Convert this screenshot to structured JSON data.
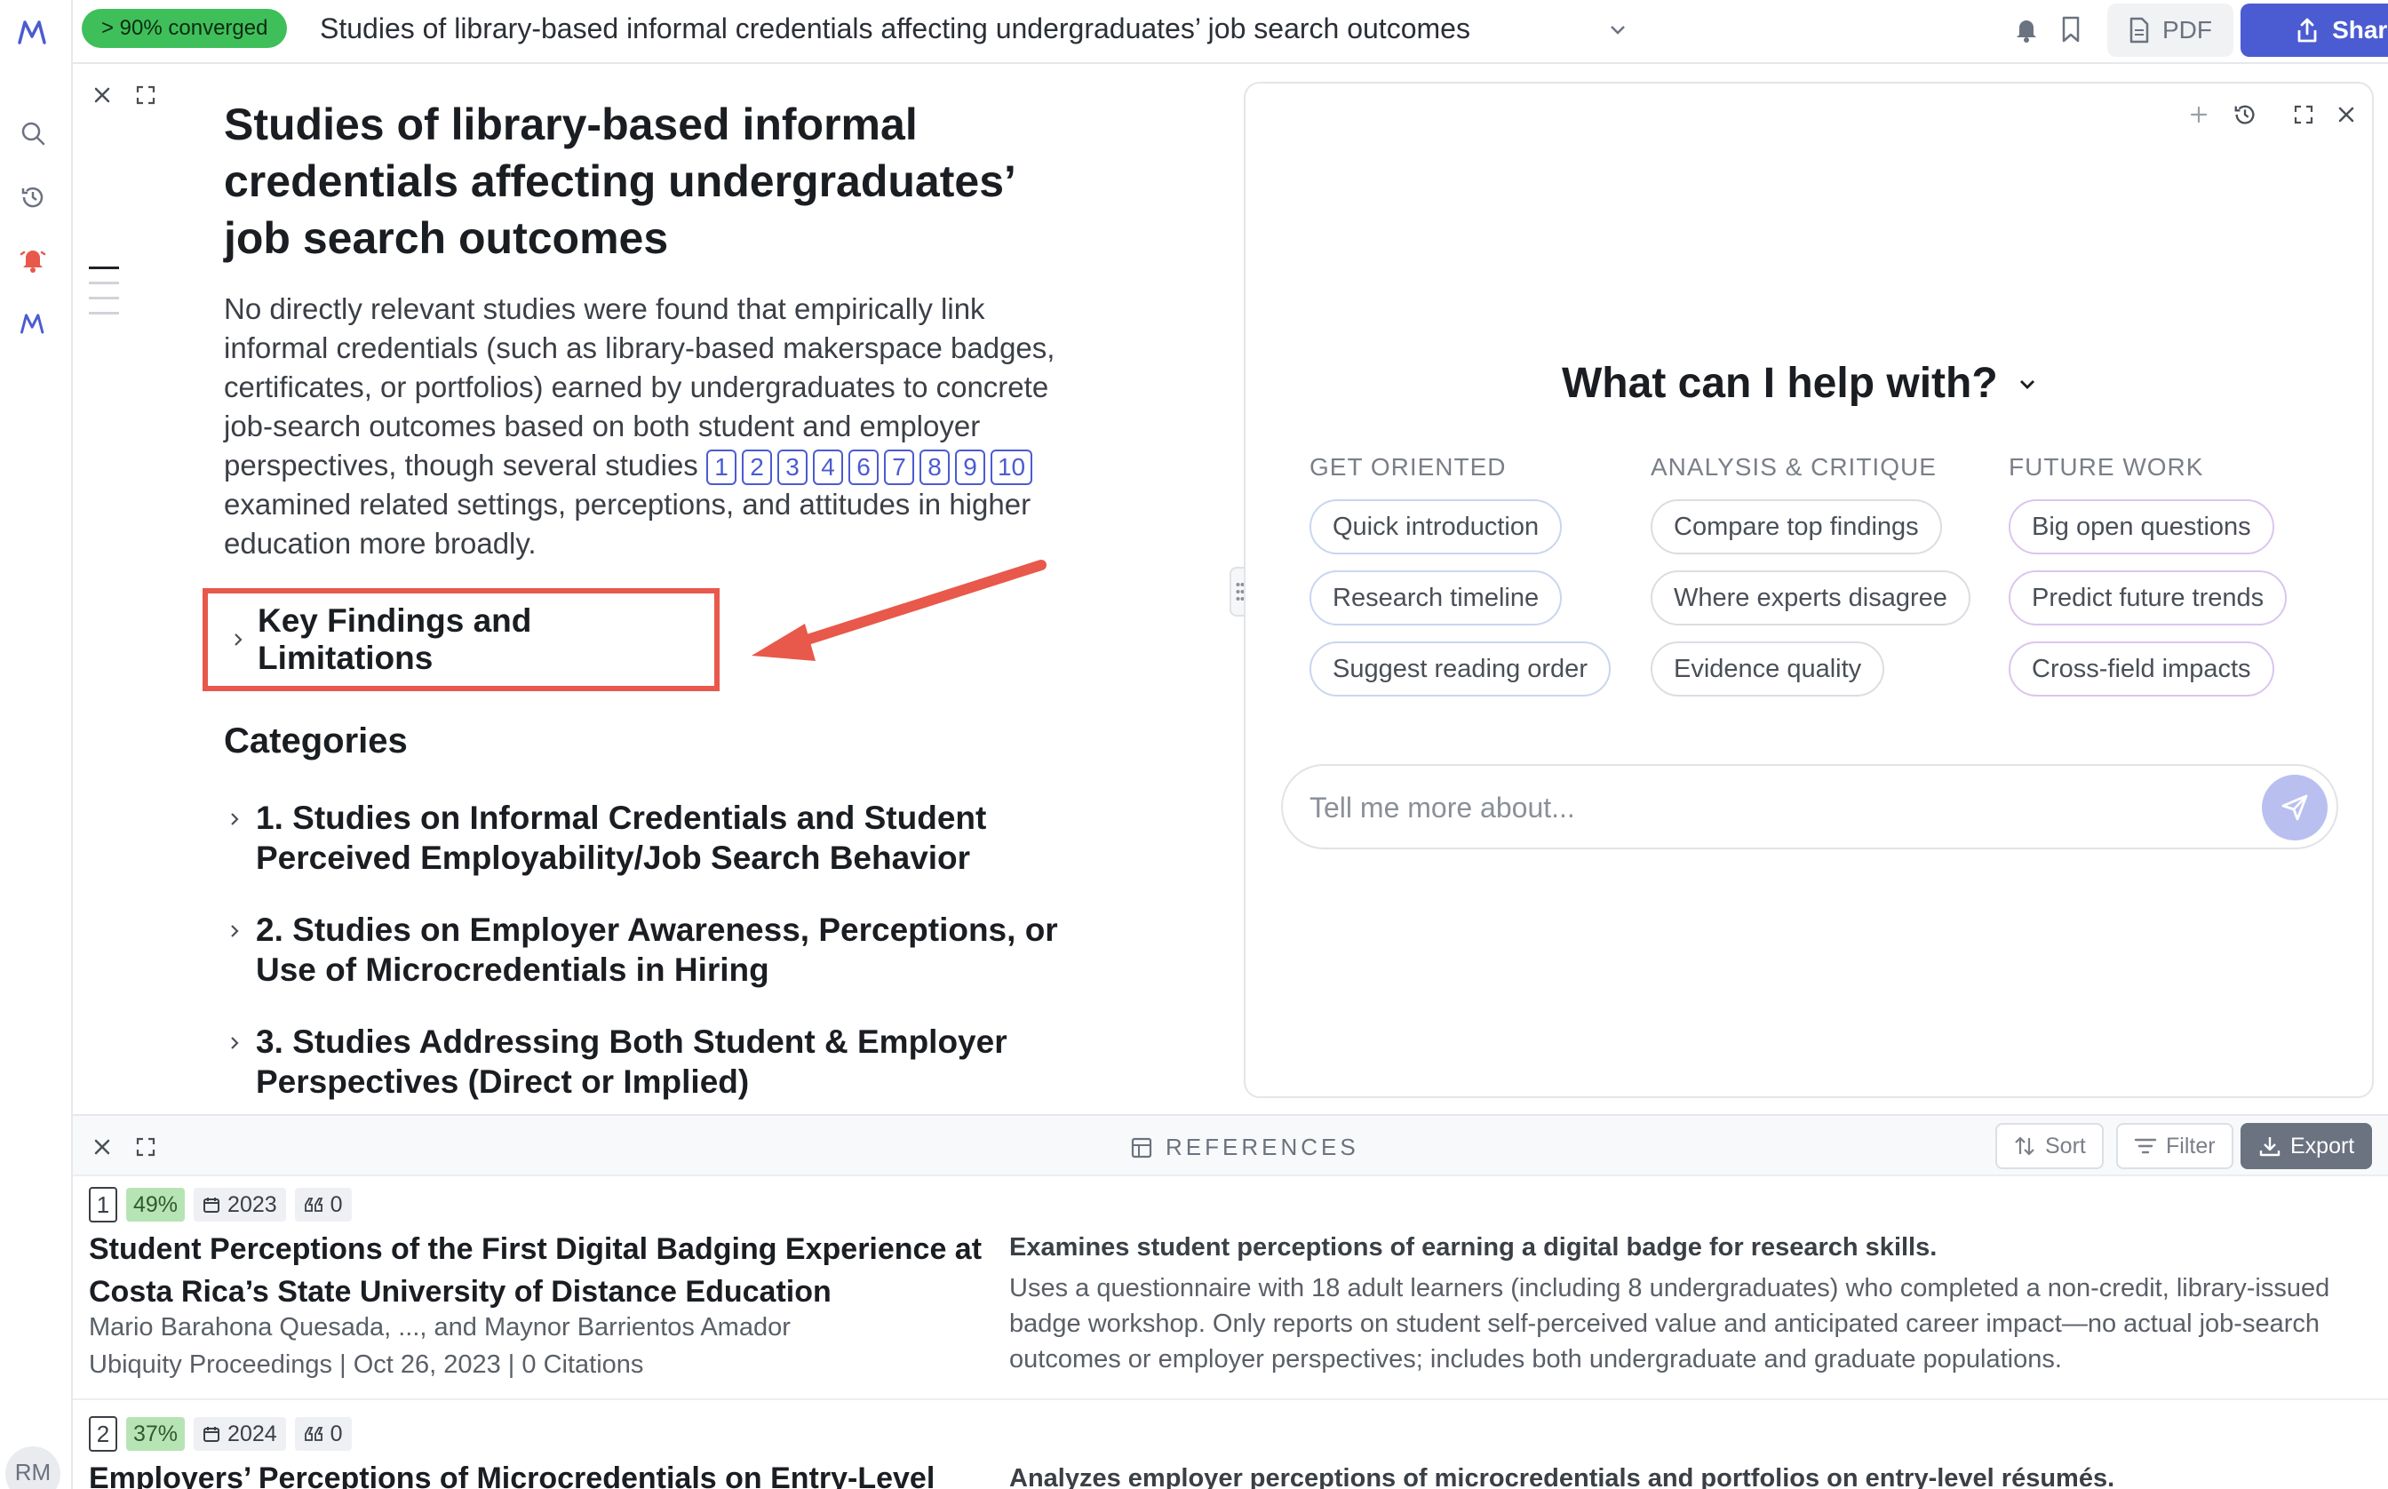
{
  "app": {
    "converged_badge": "> 90% converged",
    "document_title": "Studies of library-based informal credentials affecting undergraduates’ job search outcomes",
    "pdf_label": "PDF",
    "share_label": "Share",
    "user_initials": "RM"
  },
  "document": {
    "heading": "Studies of library-based informal credentials affecting undergraduates’ job search outcomes",
    "summary_part1": "No directly relevant studies were found that empirically link informal credentials (such as library-based makerspace badges, certificates, or portfolios) earned by undergraduates to concrete job-search outcomes based on both student and employer perspectives, though several studies ",
    "citations": [
      "1",
      "2",
      "3",
      "4",
      "6",
      "7",
      "8",
      "9",
      "10"
    ],
    "summary_part2": " examined related settings, perceptions, and attitudes in higher education more broadly.",
    "key_findings_label": "Key Findings and Limitations",
    "categories_heading": "Categories",
    "categories": [
      "1. Studies on Informal Credentials and Student Perceived Employability/Job Search Behavior",
      "2. Studies on Employer Awareness, Perceptions, or Use of Microcredentials in Hiring",
      "3. Studies Addressing Both Student & Employer Perspectives (Direct or Implied)"
    ]
  },
  "chat": {
    "prompt_heading": "What can I help with?",
    "columns": [
      {
        "heading": "GET ORIENTED",
        "color": "#c9d6ef",
        "pills": [
          "Quick introduction",
          "Research timeline",
          "Suggest reading order"
        ]
      },
      {
        "heading": "ANALYSIS & CRITIQUE",
        "color": "#dadde2",
        "pills": [
          "Compare top findings",
          "Where experts disagree",
          "Evidence quality"
        ]
      },
      {
        "heading": "FUTURE WORK",
        "color": "#dbc5ef",
        "pills": [
          "Big open questions",
          "Predict future trends",
          "Cross-field impacts"
        ]
      }
    ],
    "input_placeholder": "Tell me more about..."
  },
  "references": {
    "title": "REFERENCES",
    "sort_label": "Sort",
    "filter_label": "Filter",
    "export_label": "Export",
    "items": [
      {
        "number": "1",
        "relevance": "49%",
        "year": "2023",
        "citations_count": "0",
        "title": "Student Perceptions of the First Digital Badging Experience at Costa Rica’s State University of Distance Education",
        "authors": "Mario Barahona Quesada, ..., and Maynor Barrientos Amador",
        "venue": "Ubiquity Proceedings | Oct 26, 2023 | 0 Citations",
        "summary_head": "Examines student perceptions of earning a digital badge for research skills.",
        "summary_body": "Uses a questionnaire with 18 adult learners (including 8 undergraduates) who completed a non-credit, library-issued badge workshop. Only reports on student self-perceived value and anticipated career impact—no actual job-search outcomes or employer perspectives; includes both undergraduate and graduate populations."
      },
      {
        "number": "2",
        "relevance": "37%",
        "year": "2024",
        "citations_count": "0",
        "title": "Employers’ Perceptions of Microcredentials on Entry-Level",
        "summary_head": "Analyzes employer perceptions of microcredentials and portfolios on entry-level résumés."
      }
    ]
  }
}
